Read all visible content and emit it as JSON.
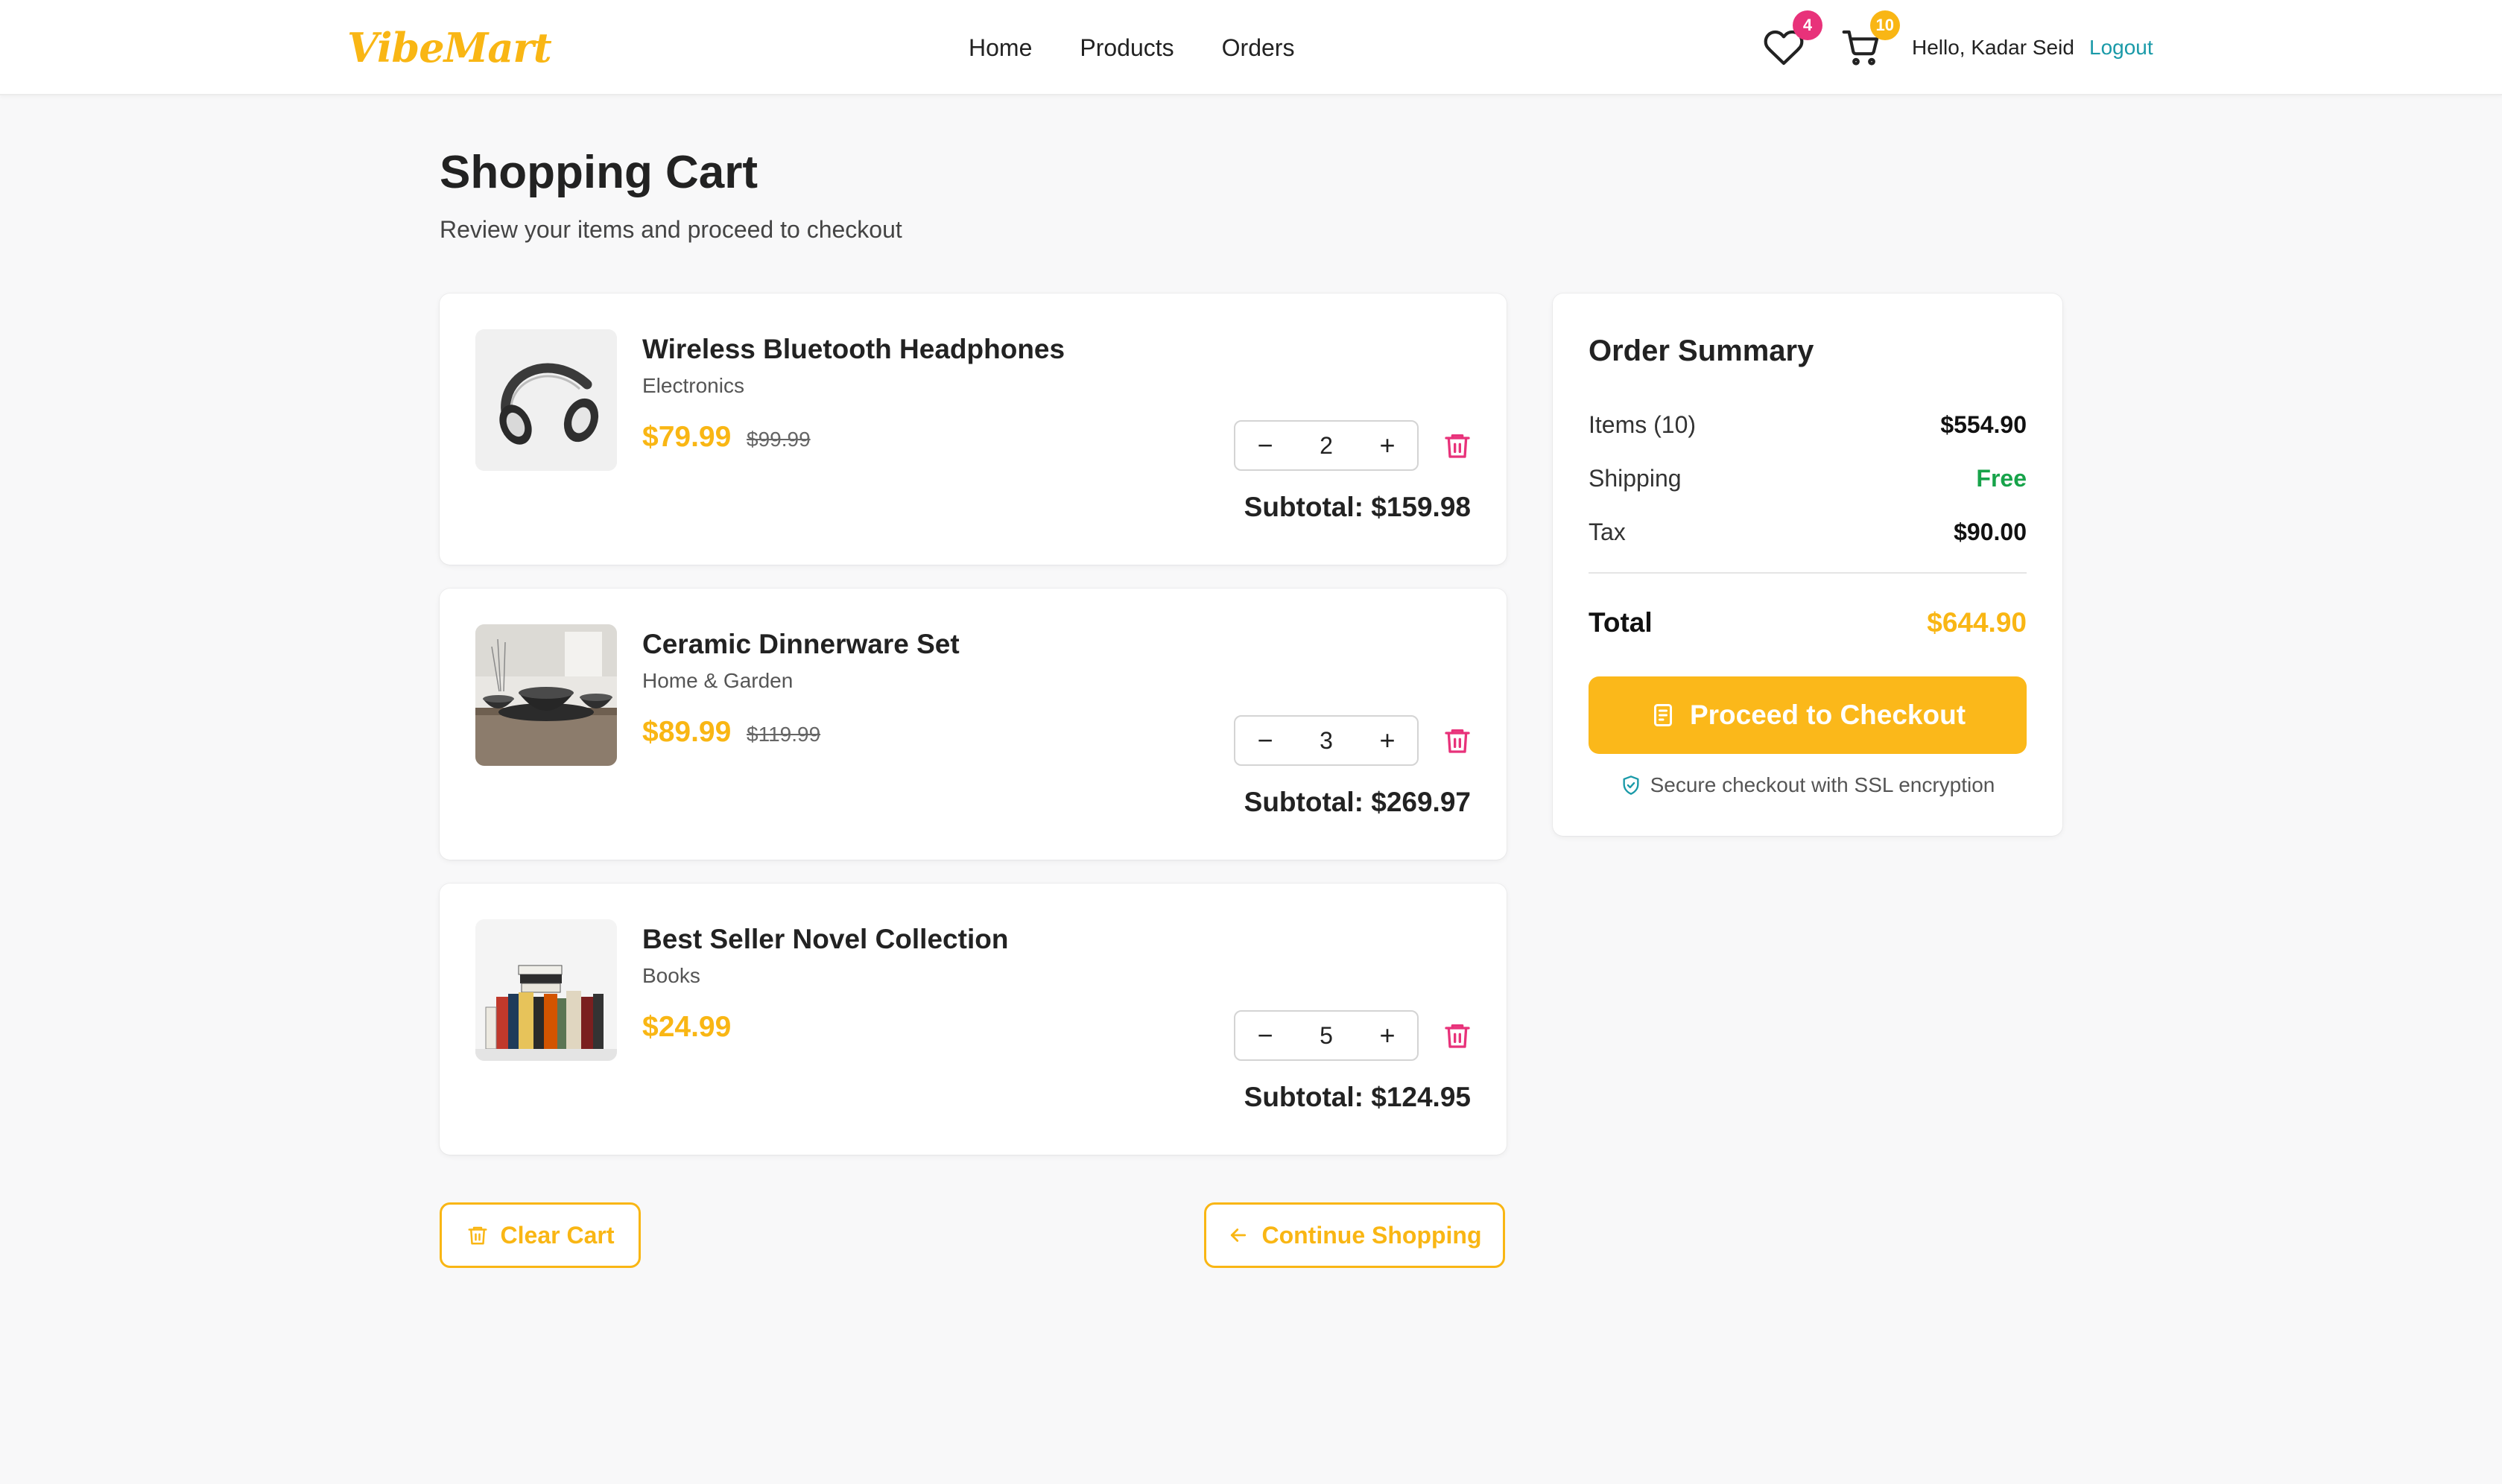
{
  "brand": {
    "name": "VibeMart",
    "color": "#f9b614"
  },
  "nav": {
    "items": [
      {
        "id": "home",
        "label": "Home"
      },
      {
        "id": "products",
        "label": "Products"
      },
      {
        "id": "orders",
        "label": "Orders"
      }
    ]
  },
  "header": {
    "wishlist_icon": "heart-icon",
    "wishlist_count": "4",
    "wishlist_badge_color": "#e8327a",
    "cart_icon": "cart-icon",
    "cart_count": "10",
    "cart_badge_color": "#f9b614",
    "greeting": "Hello, Kadar Seid",
    "logout_label": "Logout"
  },
  "page": {
    "title": "Shopping Cart",
    "subtitle": "Review your items and proceed to checkout"
  },
  "cart": {
    "items": [
      {
        "name": "Wireless Bluetooth Headphones",
        "category": "Electronics",
        "price": "$79.99",
        "original_price": "$99.99",
        "quantity": "2",
        "subtotal": "Subtotal: $159.98",
        "image_icon": "headphones-image"
      },
      {
        "name": "Ceramic Dinnerware Set",
        "category": "Home & Garden",
        "price": "$89.99",
        "original_price": "$119.99",
        "quantity": "3",
        "subtotal": "Subtotal: $269.97",
        "image_icon": "dinnerware-image"
      },
      {
        "name": "Best Seller Novel Collection",
        "category": "Books",
        "price": "$24.99",
        "original_price": "",
        "quantity": "5",
        "subtotal": "Subtotal: $124.95",
        "image_icon": "books-image"
      }
    ],
    "decrement_label": "−",
    "increment_label": "+",
    "remove_icon": "trash-icon",
    "remove_icon_color": "#e8327a",
    "clear_label": "Clear Cart",
    "continue_label": "Continue Shopping"
  },
  "summary": {
    "title": "Order Summary",
    "items_label": "Items (10)",
    "items_value": "$554.90",
    "shipping_label": "Shipping",
    "shipping_value": "Free",
    "shipping_color": "#17a34a",
    "tax_label": "Tax",
    "tax_value": "$90.00",
    "total_label": "Total",
    "total_value": "$644.90",
    "checkout_label": "Proceed to Checkout",
    "secure_text": "Secure checkout with SSL encryption",
    "secure_icon": "shield-check-icon",
    "secure_icon_color": "#1a9aa8"
  }
}
